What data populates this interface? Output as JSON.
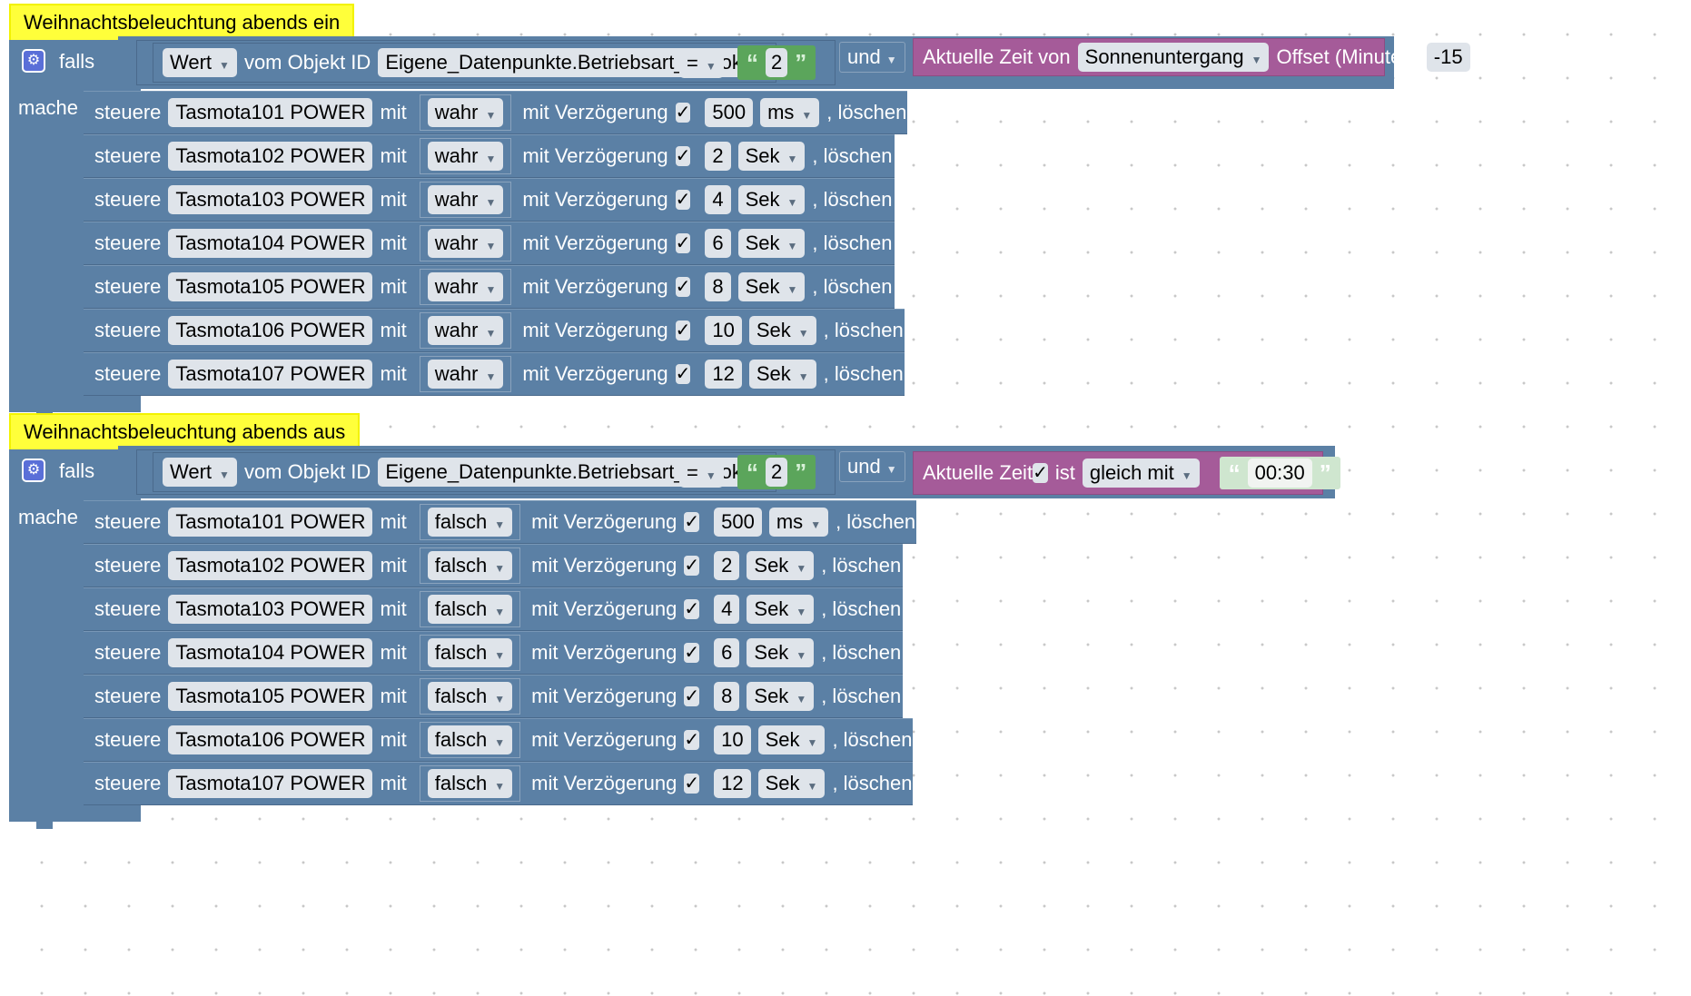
{
  "colors": {
    "logic_blue": "#5b80a5",
    "text_green": "#5ba55b",
    "time_purple": "#a55b99",
    "comment_yellow": "#ffff3a",
    "field_bg": "#dfe4ea"
  },
  "icons": {
    "gear": "gear-icon",
    "checkmark": "checkmark-icon",
    "dropdown": "chevron-down-icon"
  },
  "block1": {
    "comment": "Weihnachtsbeleuchtung abends ein",
    "if_label": "falls",
    "do_label": "mache",
    "cond": {
      "wert": "Wert",
      "vom_objekt_id": "vom Objekt ID",
      "object_id": "Eigene_Datenpunkte.Betriebsart_ioBroker",
      "operator": "=",
      "value": "2",
      "logic": "und",
      "time_label": "Aktuelle Zeit von",
      "astro": "Sonnenuntergang",
      "offset_label": "Offset (Minuten)",
      "offset": "-15"
    },
    "rows": [
      {
        "device": "Tasmota101 POWER",
        "value": "wahr",
        "delay": "500",
        "unit": "ms"
      },
      {
        "device": "Tasmota102 POWER",
        "value": "wahr",
        "delay": "2",
        "unit": "Sek"
      },
      {
        "device": "Tasmota103 POWER",
        "value": "wahr",
        "delay": "4",
        "unit": "Sek"
      },
      {
        "device": "Tasmota104 POWER",
        "value": "wahr",
        "delay": "6",
        "unit": "Sek"
      },
      {
        "device": "Tasmota105 POWER",
        "value": "wahr",
        "delay": "8",
        "unit": "Sek"
      },
      {
        "device": "Tasmota106 POWER",
        "value": "wahr",
        "delay": "10",
        "unit": "Sek"
      },
      {
        "device": "Tasmota107 POWER",
        "value": "wahr",
        "delay": "12",
        "unit": "Sek"
      }
    ]
  },
  "block2": {
    "comment": "Weihnachtsbeleuchtung abends aus",
    "if_label": "falls",
    "do_label": "mache",
    "cond": {
      "wert": "Wert",
      "vom_objekt_id": "vom Objekt ID",
      "object_id": "Eigene_Datenpunkte.Betriebsart_ioBroker",
      "operator": "=",
      "value": "2",
      "logic": "und",
      "time_label": "Aktuelle Zeit",
      "ist_label": "ist",
      "compare": "gleich mit",
      "time_value": "00:30"
    },
    "rows": [
      {
        "device": "Tasmota101 POWER",
        "value": "falsch",
        "delay": "500",
        "unit": "ms"
      },
      {
        "device": "Tasmota102 POWER",
        "value": "falsch",
        "delay": "2",
        "unit": "Sek"
      },
      {
        "device": "Tasmota103 POWER",
        "value": "falsch",
        "delay": "4",
        "unit": "Sek"
      },
      {
        "device": "Tasmota104 POWER",
        "value": "falsch",
        "delay": "6",
        "unit": "Sek"
      },
      {
        "device": "Tasmota105 POWER",
        "value": "falsch",
        "delay": "8",
        "unit": "Sek"
      },
      {
        "device": "Tasmota106 POWER",
        "value": "falsch",
        "delay": "10",
        "unit": "Sek"
      },
      {
        "device": "Tasmota107 POWER",
        "value": "falsch",
        "delay": "12",
        "unit": "Sek"
      }
    ]
  },
  "labels": {
    "steuere": "steuere",
    "mit": "mit",
    "mit_verzoegerung": "mit Verzögerung",
    "loeschen": ", löschen falls läuft",
    "check": "✓"
  }
}
